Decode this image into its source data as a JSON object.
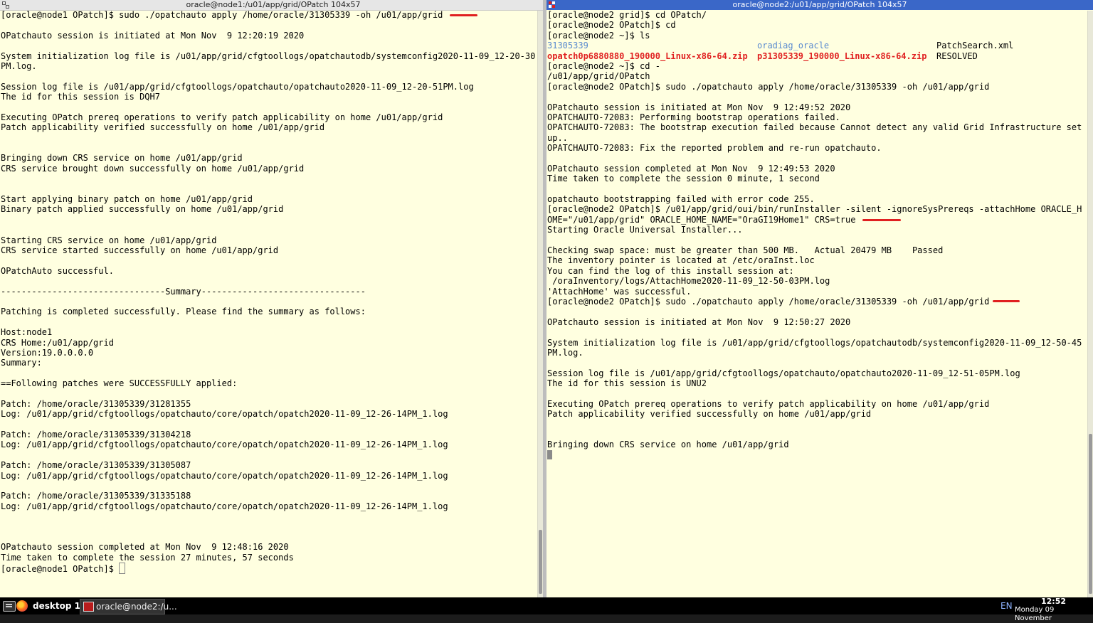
{
  "left_window": {
    "title": "oracle@node1:/u01/app/grid/OPatch 104x57",
    "lines": [
      "[oracle@node1 OPatch]$ sudo ./opatchauto apply /home/oracle/31305339 -oh /u01/app/grid",
      "",
      "OPatchauto session is initiated at Mon Nov  9 12:20:19 2020",
      "",
      "System initialization log file is /u01/app/grid/cfgtoollogs/opatchautodb/systemconfig2020-11-09_12-20-30",
      "PM.log.",
      "",
      "Session log file is /u01/app/grid/cfgtoollogs/opatchauto/opatchauto2020-11-09_12-20-51PM.log",
      "The id for this session is DQH7",
      "",
      "Executing OPatch prereq operations to verify patch applicability on home /u01/app/grid",
      "Patch applicability verified successfully on home /u01/app/grid",
      "",
      "",
      "Bringing down CRS service on home /u01/app/grid",
      "CRS service brought down successfully on home /u01/app/grid",
      "",
      "",
      "Start applying binary patch on home /u01/app/grid",
      "Binary patch applied successfully on home /u01/app/grid",
      "",
      "",
      "Starting CRS service on home /u01/app/grid",
      "CRS service started successfully on home /u01/app/grid",
      "",
      "OPatchAuto successful.",
      "",
      "--------------------------------Summary--------------------------------",
      "",
      "Patching is completed successfully. Please find the summary as follows:",
      "",
      "Host:node1",
      "CRS Home:/u01/app/grid",
      "Version:19.0.0.0.0",
      "Summary:",
      "",
      "==Following patches were SUCCESSFULLY applied:",
      "",
      "Patch: /home/oracle/31305339/31281355",
      "Log: /u01/app/grid/cfgtoollogs/opatchauto/core/opatch/opatch2020-11-09_12-26-14PM_1.log",
      "",
      "Patch: /home/oracle/31305339/31304218",
      "Log: /u01/app/grid/cfgtoollogs/opatchauto/core/opatch/opatch2020-11-09_12-26-14PM_1.log",
      "",
      "Patch: /home/oracle/31305339/31305087",
      "Log: /u01/app/grid/cfgtoollogs/opatchauto/core/opatch/opatch2020-11-09_12-26-14PM_1.log",
      "",
      "Patch: /home/oracle/31305339/31335188",
      "Log: /u01/app/grid/cfgtoollogs/opatchauto/core/opatch/opatch2020-11-09_12-26-14PM_1.log",
      "",
      "",
      "",
      "OPatchauto session completed at Mon Nov  9 12:48:16 2020",
      "Time taken to complete the session 27 minutes, 57 seconds"
    ],
    "prompt": "[oracle@node1 OPatch]$ "
  },
  "right_window": {
    "title": "oracle@node2:/u01/app/grid/OPatch 104x57",
    "lines_before_ls": [
      "[oracle@node2 grid]$ cd OPatch/",
      "[oracle@node2 OPatch]$ cd",
      "[oracle@node2 ~]$ ls"
    ],
    "ls_output": {
      "row1": [
        "31305339",
        "oradiag_oracle",
        "PatchSearch.xml"
      ],
      "row2": [
        "opatch0p6880880_190000_Linux-x86-64.zip",
        "p31305339_190000_Linux-x86-64.zip",
        "RESOLVED"
      ]
    },
    "lines_after_ls": [
      "[oracle@node2 ~]$ cd -",
      "/u01/app/grid/OPatch",
      "[oracle@node2 OPatch]$ sudo ./opatchauto apply /home/oracle/31305339 -oh /u01/app/grid",
      "",
      "OPatchauto session is initiated at Mon Nov  9 12:49:52 2020",
      "OPATCHAUTO-72083: Performing bootstrap operations failed.",
      "OPATCHAUTO-72083: The bootstrap execution failed because Cannot detect any valid Grid Infrastructure set",
      "up..",
      "OPATCHAUTO-72083: Fix the reported problem and re-run opatchauto.",
      "",
      "OPatchauto session completed at Mon Nov  9 12:49:53 2020",
      "Time taken to complete the session 0 minute, 1 second",
      "",
      "opatchauto bootstrapping failed with error code 255.",
      "[oracle@node2 OPatch]$ /u01/app/grid/oui/bin/runInstaller -silent -ignoreSysPrereqs -attachHome ORACLE_H",
      "OME=\"/u01/app/grid\" ORACLE_HOME_NAME=\"OraGI19Home1\" CRS=true",
      "Starting Oracle Universal Installer...",
      "",
      "Checking swap space: must be greater than 500 MB.   Actual 20479 MB    Passed",
      "The inventory pointer is located at /etc/oraInst.loc",
      "You can find the log of this install session at:",
      " /oraInventory/logs/AttachHome2020-11-09_12-50-03PM.log",
      "'AttachHome' was successful.",
      "[oracle@node2 OPatch]$ sudo ./opatchauto apply /home/oracle/31305339 -oh /u01/app/grid",
      "",
      "OPatchauto session is initiated at Mon Nov  9 12:50:27 2020",
      "",
      "System initialization log file is /u01/app/grid/cfgtoollogs/opatchautodb/systemconfig2020-11-09_12-50-45",
      "PM.log.",
      "",
      "Session log file is /u01/app/grid/cfgtoollogs/opatchauto/opatchauto2020-11-09_12-51-05PM.log",
      "The id for this session is UNU2",
      "",
      "Executing OPatch prereq operations to verify patch applicability on home /u01/app/grid",
      "Patch applicability verified successfully on home /u01/app/grid",
      "",
      "",
      "Bringing down CRS service on home /u01/app/grid"
    ]
  },
  "taskbar": {
    "desktop_label": "desktop 1",
    "task_label": "oracle@node2:/u...",
    "language": "EN",
    "time": "12:52",
    "date": "Monday 09 November"
  },
  "colors": {
    "terminal_bg": "#ffffe0",
    "directory": "#5b8bcf",
    "archive": "#e02020",
    "annotation": "#e02020",
    "active_title": "#3a67c8"
  },
  "icons": {
    "menu": "app-menu-icon",
    "browser": "firefox-icon",
    "terminal": "terminal-icon"
  }
}
